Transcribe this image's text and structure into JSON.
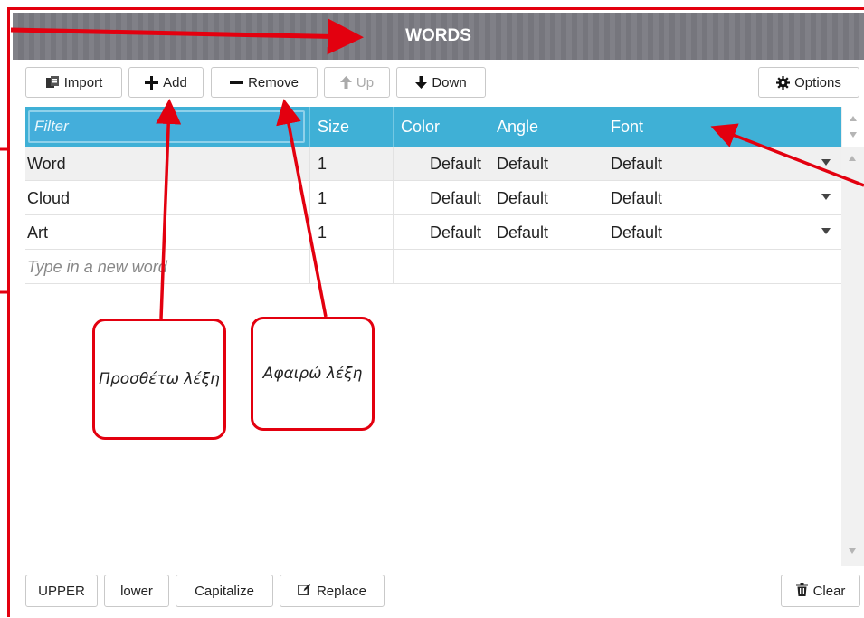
{
  "window": {
    "title": "WORDS"
  },
  "toolbar": {
    "import_label": "Import",
    "add_label": "Add",
    "remove_label": "Remove",
    "up_label": "Up",
    "down_label": "Down",
    "options_label": "Options"
  },
  "grid": {
    "filter_placeholder": "Filter",
    "columns": [
      "Size",
      "Color",
      "Angle",
      "Font"
    ],
    "rows": [
      {
        "word": "Word",
        "size": "1",
        "color": "Default",
        "angle": "Default",
        "font": "Default"
      },
      {
        "word": "Cloud",
        "size": "1",
        "color": "Default",
        "angle": "Default",
        "font": "Default"
      },
      {
        "word": "Art",
        "size": "1",
        "color": "Default",
        "angle": "Default",
        "font": "Default"
      }
    ],
    "new_word_placeholder": "Type in a new word"
  },
  "bottom": {
    "upper_label": "UPPER",
    "lower_label": "lower",
    "capitalize_label": "Capitalize",
    "replace_label": "Replace",
    "clear_label": "Clear"
  },
  "annotations": {
    "add_note": "Προσθέτω λέξη",
    "remove_note": "Αφαιρώ λέξη",
    "color": "#e3000f"
  },
  "colors": {
    "header": "#3fb0d6",
    "titlebar": "#7b7b82",
    "annotation": "#e3000f"
  }
}
